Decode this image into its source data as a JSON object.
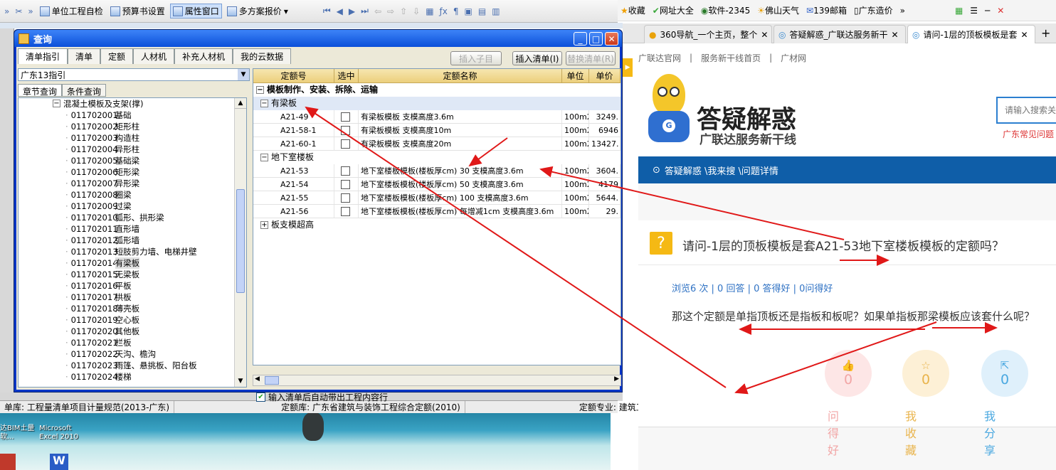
{
  "app_toolbar": {
    "items": [
      "单位工程自检",
      "预算书设置",
      "属性窗口",
      "多方案报价"
    ],
    "active": "属性窗口"
  },
  "status_bar": {
    "segments": [
      "单库: 工程量清单项目计量规范(2013-广东)",
      "定额库: 广东省建筑与装饰工程综合定额(2010)",
      "定额专业: 建筑工"
    ]
  },
  "desktop": {
    "icons": [
      "达BIM土量软...",
      "Microsoft Excel 2010"
    ]
  },
  "dialog": {
    "title": "查询",
    "tabs": [
      "清单指引",
      "清单",
      "定额",
      "人材机",
      "补充人材机",
      "我的云数据"
    ],
    "buttons": {
      "insert_child": "插入子目",
      "insert_list": "插入清单(I)",
      "replace_list": "替换清单(R)"
    },
    "library": "广东13指引",
    "subtabs": [
      "章节查询",
      "条件查询"
    ],
    "tree": {
      "parent": "混凝土模板及支架(撑)",
      "items": [
        {
          "code": "011702001",
          "name": "基础"
        },
        {
          "code": "011702002",
          "name": "矩形柱"
        },
        {
          "code": "011702003",
          "name": "构造柱"
        },
        {
          "code": "011702004",
          "name": "异形柱"
        },
        {
          "code": "011702005",
          "name": "基础梁"
        },
        {
          "code": "011702006",
          "name": "矩形梁"
        },
        {
          "code": "011702007",
          "name": "异形梁"
        },
        {
          "code": "011702008",
          "name": "圈梁"
        },
        {
          "code": "011702009",
          "name": "过梁"
        },
        {
          "code": "011702010",
          "name": "弧形、拱形梁"
        },
        {
          "code": "011702011",
          "name": "直形墙"
        },
        {
          "code": "011702012",
          "name": "弧形墙"
        },
        {
          "code": "011702013",
          "name": "短肢剪力墙、电梯井壁"
        },
        {
          "code": "011702014",
          "name": "有梁板"
        },
        {
          "code": "011702015",
          "name": "无梁板"
        },
        {
          "code": "011702016",
          "name": "平板"
        },
        {
          "code": "011702017",
          "name": "拱板"
        },
        {
          "code": "011702018",
          "name": "薄壳板"
        },
        {
          "code": "011702019",
          "name": "空心板"
        },
        {
          "code": "011702020",
          "name": "其他板"
        },
        {
          "code": "011702021",
          "name": "栏板"
        },
        {
          "code": "011702022",
          "name": "天沟、檐沟"
        },
        {
          "code": "011702023",
          "name": "雨篷、悬挑板、阳台板"
        },
        {
          "code": "011702024",
          "name": "楼梯"
        }
      ],
      "selected": "011702014"
    },
    "grid": {
      "columns": [
        "定额号",
        "选中",
        "定额名称",
        "单位",
        "单价"
      ],
      "section": "模板制作、安装、拆除、运输",
      "groups": [
        {
          "name": "有梁板",
          "rows": [
            {
              "code": "A21-49",
              "name": "有梁板模板 支模高度3.6m",
              "unit": "100m2",
              "price": "3249."
            },
            {
              "code": "A21-58-1",
              "name": "有梁板模板 支模高度10m",
              "unit": "100m2",
              "price": "6946"
            },
            {
              "code": "A21-60-1",
              "name": "有梁板模板 支模高度20m",
              "unit": "100m2",
              "price": "13427."
            }
          ]
        },
        {
          "name": "地下室楼板",
          "rows": [
            {
              "code": "A21-53",
              "name": "地下室楼板模板(楼板厚cm) 30 支模高度3.6m",
              "unit": "100m2",
              "price": "3604."
            },
            {
              "code": "A21-54",
              "name": "地下室楼板模板(楼板厚cm) 50 支模高度3.6m",
              "unit": "100m2",
              "price": "4179"
            },
            {
              "code": "A21-55",
              "name": "地下室楼板模板(楼板厚cm) 100 支模高度3.6m",
              "unit": "100m2",
              "price": "5644."
            },
            {
              "code": "A21-56",
              "name": "地下室楼板模板(楼板厚cm) 每增减1cm 支模高度3.6m",
              "unit": "100m2",
              "price": "29."
            }
          ]
        },
        {
          "name": "板支模超高",
          "rows": []
        }
      ]
    },
    "auto_bring": "输入清单后自动带出工程内容行"
  },
  "browser": {
    "bookmarks": [
      "收藏",
      "网址大全",
      "软件-2345",
      "佛山天气",
      "139邮箱",
      "广东造价"
    ],
    "tabs": [
      "360导航_一个主页，整个",
      "答疑解惑_广联达服务新干",
      "请问-1层的顶板模板是套"
    ],
    "nav": [
      "广联达官网",
      "服务新干线首页",
      "广材网"
    ],
    "logo_title": "答疑解惑",
    "logo_sub": "广联达服务新干线",
    "search_placeholder": "请输入搜索关",
    "search_hint": "广东常见问题",
    "breadcrumb": "答疑解惑 \\我来搜 \\问题详情",
    "question": "请问-1层的顶板模板是套A21-53地下室楼板模板的定额吗？",
    "stats": "浏览6 次 | 0 回答 | 0 答得好 | 0问得好",
    "body": "那这个定额是单指顶板还是指板和板呢？如果单指板那梁模板应该套什么呢？",
    "actions": [
      {
        "label": "问得好",
        "count": "0",
        "color": "#f2a6a6",
        "bg": "#fde6e6"
      },
      {
        "label": "我收藏",
        "count": "0",
        "color": "#e9b44c",
        "bg": "#fdf0d6"
      },
      {
        "label": "我分享",
        "count": "0",
        "color": "#4aa8e0",
        "bg": "#dff0fb"
      }
    ]
  },
  "colors": {
    "accent_blue": "#0f5ea8",
    "arrow_red": "#e01818",
    "dialog_title": "#0b4fd9"
  }
}
